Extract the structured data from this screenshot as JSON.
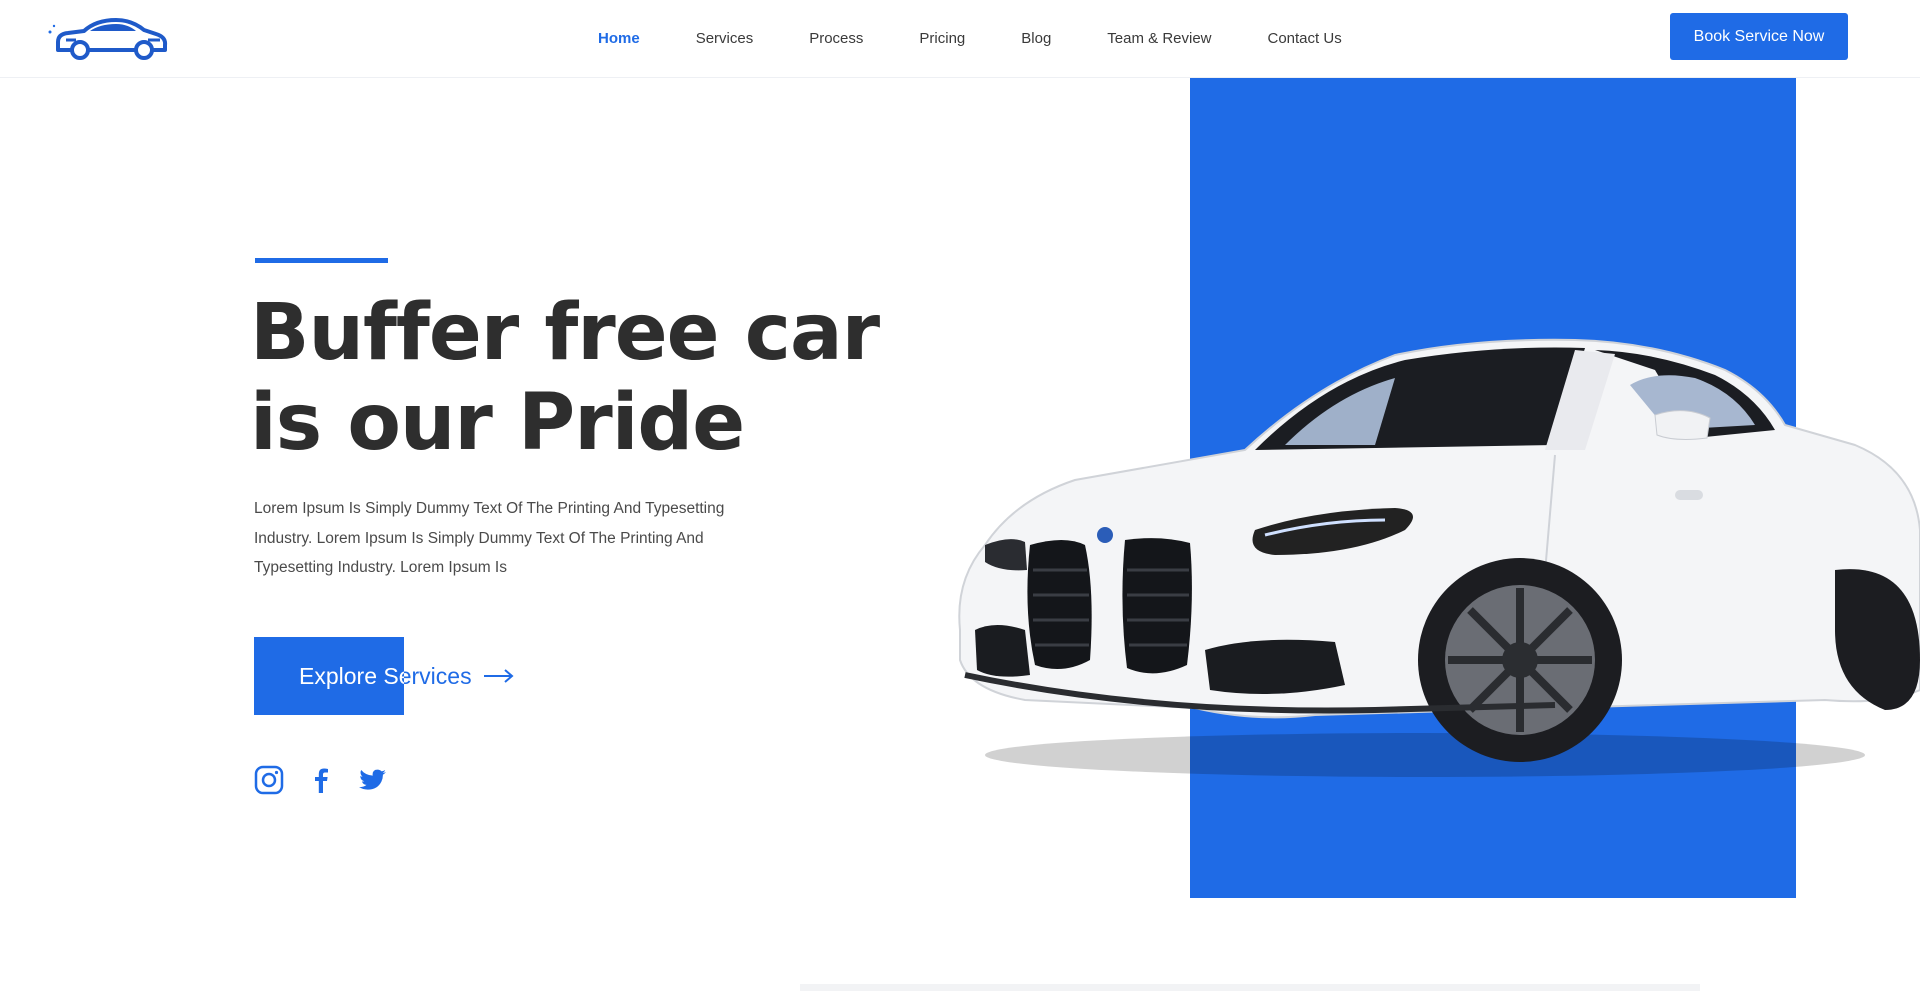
{
  "nav": {
    "links": [
      {
        "label": "Home",
        "active": true
      },
      {
        "label": "Services"
      },
      {
        "label": "Process"
      },
      {
        "label": "Pricing"
      },
      {
        "label": "Blog"
      },
      {
        "label": "Team & Review"
      },
      {
        "label": "Contact Us"
      }
    ],
    "cta_label": "Book Service Now"
  },
  "hero": {
    "title_line1": "Buffer free car",
    "title_line2": "is our Pride",
    "description_line1": "Lorem Ipsum Is Simply Dummy Text Of The Printing And Typesetting",
    "description_line2": "Industry. Lorem Ipsum Is Simply Dummy Text Of The Printing And",
    "description_line3": "Typesetting Industry. Lorem Ipsum Is",
    "button_label": "Explore Services"
  },
  "socials": [
    "instagram-icon",
    "facebook-icon",
    "twitter-icon"
  ],
  "colors": {
    "accent": "#1f6be6",
    "heading": "#2e2e2e",
    "body_text": "#4a4a4a"
  }
}
